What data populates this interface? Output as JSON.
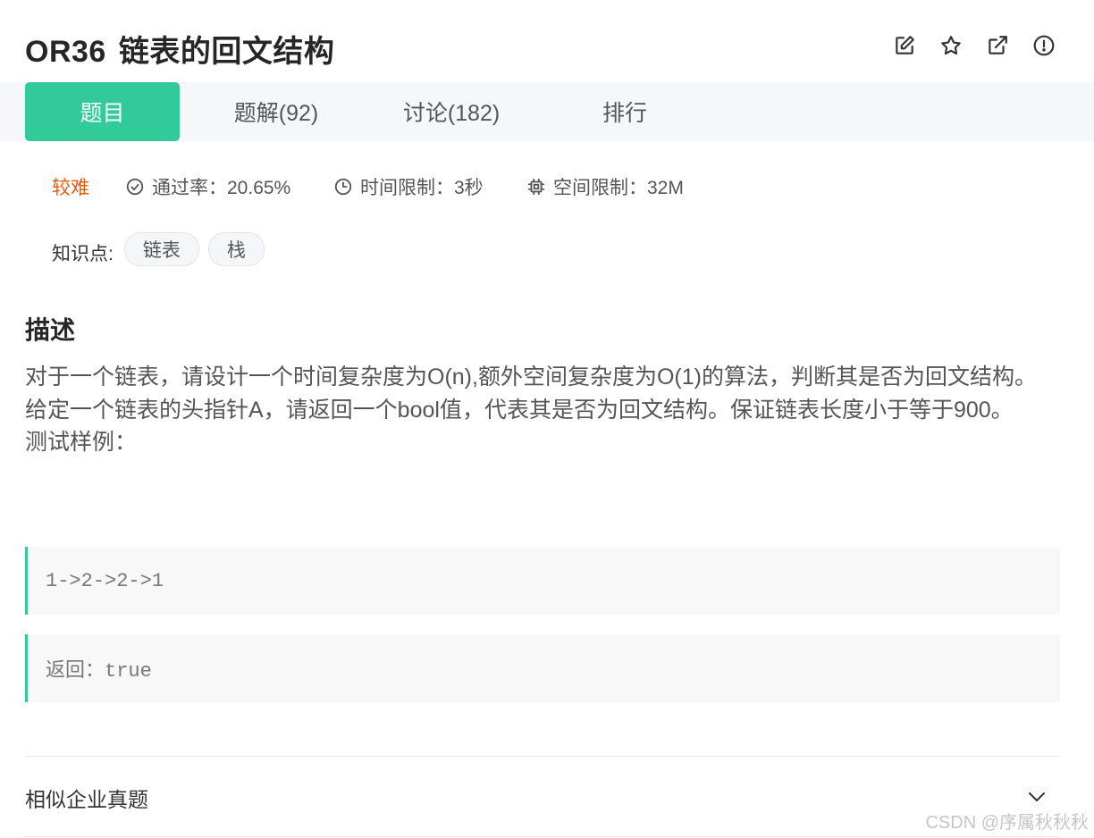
{
  "problem": {
    "id": "OR36",
    "name": "链表的回文结构"
  },
  "header_icons": [
    "edit-icon",
    "star-icon",
    "share-icon",
    "report-icon"
  ],
  "tabs": [
    {
      "label": "题目",
      "active": true
    },
    {
      "label": "题解(92)",
      "active": false
    },
    {
      "label": "讨论(182)",
      "active": false
    },
    {
      "label": "排行",
      "active": false
    }
  ],
  "meta": {
    "difficulty": "较难",
    "pass_rate": "通过率：20.65%",
    "time_limit": "时间限制：3秒",
    "space_limit": "空间限制：32M"
  },
  "knowledge": {
    "label": "知识点:",
    "tags": [
      "链表",
      "栈"
    ]
  },
  "description": {
    "heading": "描述",
    "lines": [
      "对于一个链表，请设计一个时间复杂度为O(n),额外空间复杂度为O(1)的算法，判断其是否为回文结构。",
      "给定一个链表的头指针A，请返回一个bool值，代表其是否为回文结构。保证链表长度小于等于900。",
      "测试样例："
    ]
  },
  "examples": [
    "1->2->2->1",
    "返回：true"
  ],
  "similar": {
    "label": "相似企业真题"
  },
  "watermark": "CSDN @序属秋秋秋",
  "colors": {
    "accent": "#32ca99",
    "difficulty": "#e8590c"
  }
}
